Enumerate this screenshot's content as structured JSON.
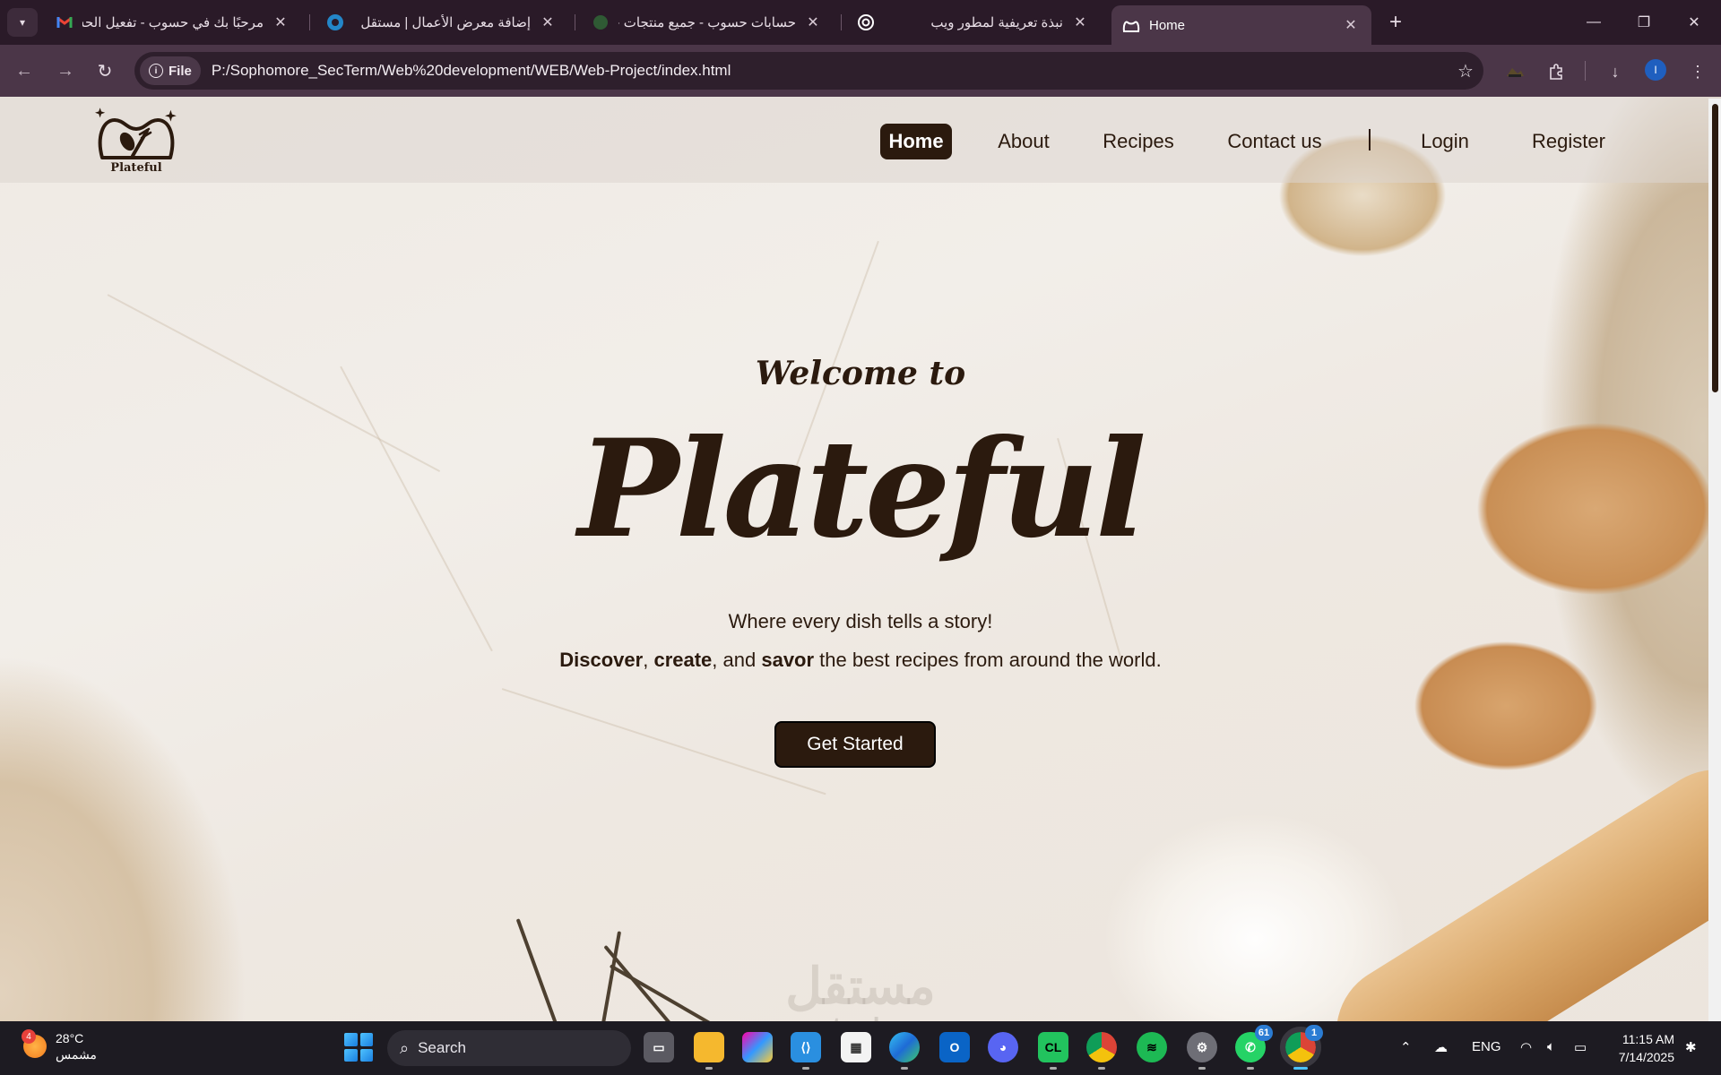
{
  "browser": {
    "tabs": [
      {
        "title": "مرحبًا بك في حسوب - تفعيل الحساب",
        "favicon": "gmail-icon",
        "active": false
      },
      {
        "title": "إضافة معرض الأعمال | مستقل",
        "favicon": "mostaql-icon",
        "active": false
      },
      {
        "title": "حسابات حسوب - جميع منتجات حسوب",
        "favicon": "hsoub-icon",
        "active": false
      },
      {
        "title": "نبذة تعريفية لمطور ويب",
        "favicon": "chatgpt-icon",
        "active": false
      },
      {
        "title": "Home",
        "favicon": "plateful-icon",
        "active": true
      }
    ],
    "address": {
      "chip_label": "File",
      "url": "P:/Sophomore_SecTerm/Web%20development/WEB/Web-Project/index.html"
    },
    "profile_initial": "I"
  },
  "site": {
    "logo_text": "Plateful",
    "nav": {
      "home": "Home",
      "about": "About",
      "recipes": "Recipes",
      "contact": "Contact us",
      "separator": "|",
      "login": "Login",
      "register": "Register"
    },
    "hero": {
      "welcome": "Welcome to",
      "title": "Plateful",
      "tagline": "Where every dish tells a story!",
      "desc_discover": "Discover",
      "desc_comma1": ", ",
      "desc_create": "create",
      "desc_and": ", and ",
      "desc_savor": "savor",
      "desc_rest": " the best recipes from around the world.",
      "cta": "Get Started"
    },
    "watermark": {
      "arabic": "مستقل",
      "latin": "mostaql.com"
    }
  },
  "taskbar": {
    "weather": {
      "temp": "28°C",
      "condition": "مشمس",
      "badge": "4"
    },
    "search_placeholder": "Search",
    "whatsapp_badge": "61",
    "chrome_badge": "1",
    "language": "ENG",
    "time": "11:15 AM",
    "date": "7/14/2025"
  },
  "colors": {
    "brand_dark": "#2b1a0e",
    "chrome_bg": "#2a1a28",
    "toolbar_bg": "#4b3648",
    "page_bg": "#efeae4"
  }
}
